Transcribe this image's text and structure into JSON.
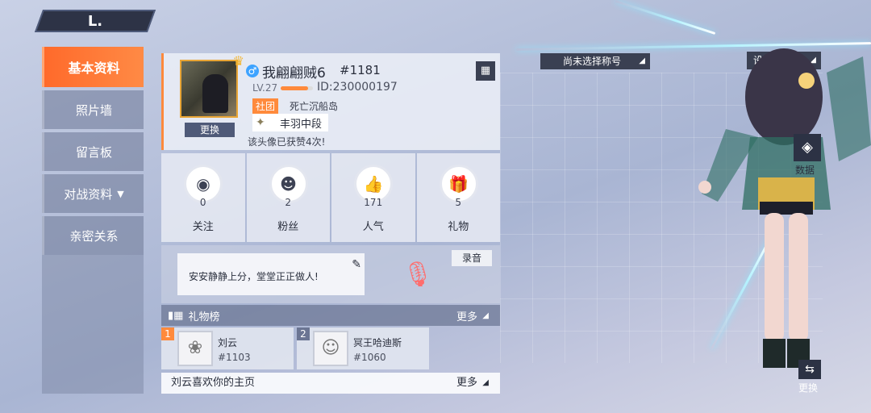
{
  "back_button": {
    "label": "L."
  },
  "menu": {
    "items": [
      {
        "label": "基本资料",
        "active": true
      },
      {
        "label": "照片墙"
      },
      {
        "label": "留言板"
      },
      {
        "label": "对战资料",
        "has_chevron": true
      },
      {
        "label": "亲密关系"
      }
    ]
  },
  "profile": {
    "gender": "♂",
    "nickname": "我翩翩贼6",
    "tag": "#1181",
    "level": "LV.27",
    "exp_fraction": 0.85,
    "player_id": "ID:230000197",
    "club_badge": "社团",
    "club_name": "死亡沉船岛",
    "rank": "丰羽中段",
    "change_avatar_label": "更换",
    "likes_text": "该头像已获赞4次!"
  },
  "stats": [
    {
      "label": "关注",
      "value": "0",
      "icon": "eye-icon"
    },
    {
      "label": "粉丝",
      "value": "2",
      "icon": "fans-icon"
    },
    {
      "label": "人气",
      "value": "171",
      "icon": "thumbs-up-icon"
    },
    {
      "label": "礼物",
      "value": "5",
      "icon": "gift-icon"
    }
  ],
  "motto": {
    "text": "安安静静上分，堂堂正正做人!"
  },
  "voice": {
    "record_label": "录音"
  },
  "gift_ranking": {
    "title": "礼物榜",
    "more_label": "更多",
    "entries": [
      {
        "rank": "1",
        "name": "刘云",
        "uid": "#1103"
      },
      {
        "rank": "2",
        "name": "冥王哈迪斯",
        "uid": "#1060"
      }
    ]
  },
  "visitor": {
    "text": "刘云喜欢你的主页",
    "more_label": "更多"
  },
  "right_panel": {
    "title_select": "尚未选择称号",
    "settings": "设置",
    "data_label": "数据",
    "swap_label": "更换"
  }
}
